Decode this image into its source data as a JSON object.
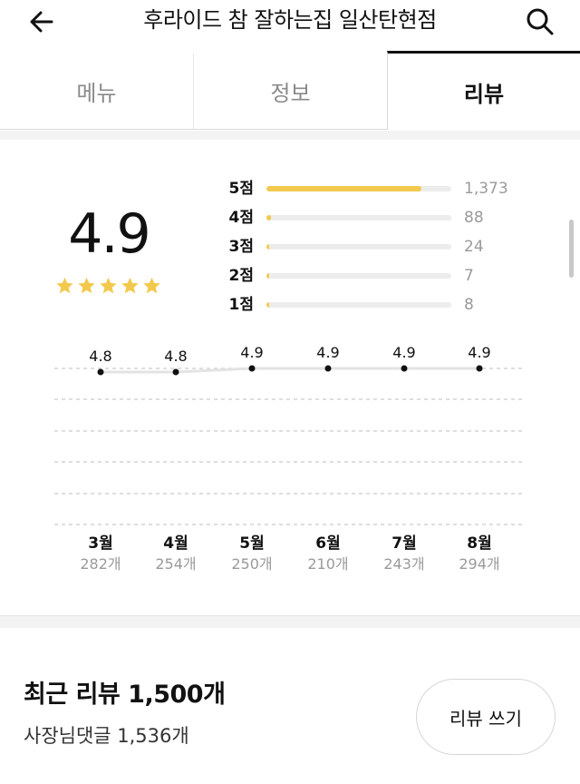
{
  "header": {
    "title": "후라이드 참 잘하는집 일산탄현점",
    "back_icon": "arrow-left-icon",
    "search_icon": "search-icon"
  },
  "tabs": [
    {
      "label": "메뉴",
      "active": false
    },
    {
      "label": "정보",
      "active": false
    },
    {
      "label": "리뷰",
      "active": true
    }
  ],
  "rating": {
    "average": "4.9",
    "stars": 5,
    "star_color": "#f2c94c"
  },
  "distribution": [
    {
      "label": "5점",
      "count": "1,373",
      "fraction": 0.84
    },
    {
      "label": "4점",
      "count": "88",
      "fraction": 0.025
    },
    {
      "label": "3점",
      "count": "24",
      "fraction": 0.008
    },
    {
      "label": "2점",
      "count": "7",
      "fraction": 0.003
    },
    {
      "label": "1점",
      "count": "8",
      "fraction": 0.003
    }
  ],
  "trend": {
    "months": [
      {
        "label": "3월",
        "value": 4.8,
        "value_text": "4.8",
        "count": "282개"
      },
      {
        "label": "4월",
        "value": 4.8,
        "value_text": "4.8",
        "count": "254개"
      },
      {
        "label": "5월",
        "value": 4.9,
        "value_text": "4.9",
        "count": "250개"
      },
      {
        "label": "6월",
        "value": 4.9,
        "value_text": "4.9",
        "count": "210개"
      },
      {
        "label": "7월",
        "value": 4.9,
        "value_text": "4.9",
        "count": "243개"
      },
      {
        "label": "8월",
        "value": 4.9,
        "value_text": "4.9",
        "count": "294개"
      }
    ]
  },
  "recent": {
    "title": "최근 리뷰 1,500개",
    "owner_reply": "사장님댓글 1,536개",
    "write_button": "리뷰 쓰기"
  },
  "colors": {
    "accent": "#f2c94c",
    "muted_text": "#9a9a9a",
    "track": "#ececec"
  }
}
